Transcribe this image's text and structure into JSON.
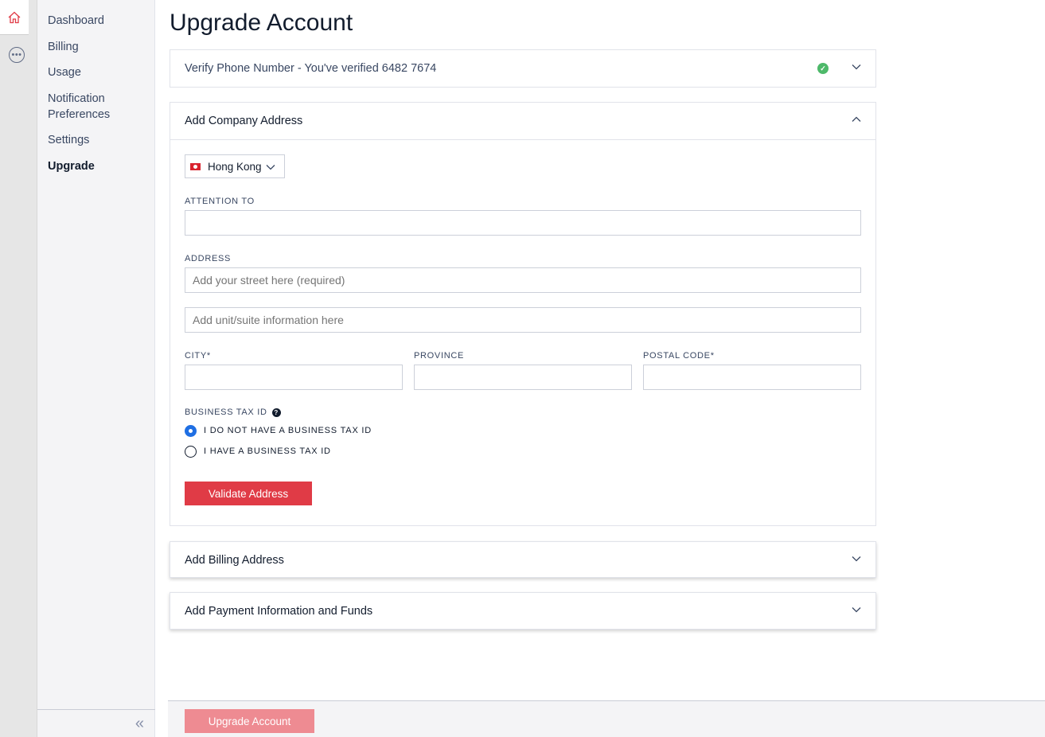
{
  "rail": {
    "home_icon": "home-icon",
    "more_icon": "more-icon",
    "accent": "#e03b46"
  },
  "sidebar": {
    "items": [
      {
        "label": "Dashboard"
      },
      {
        "label": "Billing"
      },
      {
        "label": "Usage"
      },
      {
        "label": "Notification Preferences"
      },
      {
        "label": "Settings"
      },
      {
        "label": "Upgrade",
        "active": true
      }
    ],
    "collapse_glyph": "«"
  },
  "page": {
    "title": "Upgrade Account"
  },
  "verify_panel": {
    "title": "Verify Phone Number - You've verified 6482 7674",
    "status": "verified",
    "status_color": "#4eb96a"
  },
  "company_panel": {
    "title": "Add Company Address",
    "country": "Hong Kong",
    "attention_label": "ATTENTION TO",
    "attention_value": "",
    "address_label": "ADDRESS",
    "street_placeholder": "Add your street here (required)",
    "unit_placeholder": "Add unit/suite information here",
    "city_label": "CITY*",
    "province_label": "PROVINCE",
    "postal_label": "POSTAL CODE*",
    "tax_label": "BUSINESS TAX ID",
    "tax_options": [
      {
        "label": "I DO NOT HAVE A BUSINESS TAX ID",
        "selected": true
      },
      {
        "label": "I HAVE A BUSINESS TAX ID",
        "selected": false
      }
    ],
    "validate_button": "Validate Address",
    "button_color": "#e03b46"
  },
  "billing_panel": {
    "title": "Add Billing Address"
  },
  "payment_panel": {
    "title": "Add Payment Information and Funds"
  },
  "footer": {
    "upgrade_button": "Upgrade Account",
    "button_color": "#ee8b92",
    "button_disabled": true
  }
}
